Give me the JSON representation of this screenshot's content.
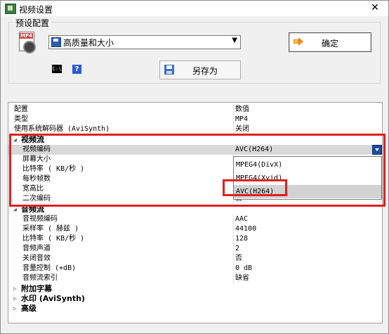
{
  "window": {
    "title": "视频设置",
    "close": "✕"
  },
  "preset": {
    "legend": "预设配置",
    "selected": "高质量和大小",
    "ok_label": "确定",
    "save_as_label": "另存为",
    "file_icon_label": "MP4",
    "cmd_icon_label": "C:\\",
    "help_icon_label": "?"
  },
  "grid": {
    "header": {
      "key": "配置",
      "value": "数值"
    },
    "top_rows": [
      {
        "key": "类型",
        "value": "MP4"
      },
      {
        "key": "使用系统解码器 (AviSynth)",
        "value": "关闭"
      }
    ],
    "video": {
      "label": "视频流",
      "rows": [
        {
          "key": "视频编码",
          "value": "AVC(H264)"
        },
        {
          "key": "屏幕大小",
          "value": ""
        },
        {
          "key": "比特率 ( KB/秒 )",
          "value": ""
        },
        {
          "key": "每秒帧数",
          "value": ""
        },
        {
          "key": "宽高比",
          "value": ""
        },
        {
          "key": "二次编码",
          "value": "否"
        }
      ],
      "dropdown_options": [
        "MPEG4(DivX)",
        "MPEG4(Xvid)",
        "AVC(H264)"
      ]
    },
    "audio": {
      "label": "音频流",
      "rows": [
        {
          "key": "音视频编码",
          "value": "AAC"
        },
        {
          "key": "采样率 ( 赫兹 )",
          "value": "44100"
        },
        {
          "key": "比特率 ( KB/秒 )",
          "value": "128"
        },
        {
          "key": "音频声道",
          "value": "2"
        },
        {
          "key": "关闭音效",
          "value": "否"
        },
        {
          "key": "音量控制 (+dB)",
          "value": "0 dB"
        },
        {
          "key": "音频流索引",
          "value": "缺省"
        }
      ]
    },
    "collapsed": [
      {
        "label": "附加字幕"
      },
      {
        "label": "水印 (AviSynth)"
      },
      {
        "label": "高级"
      }
    ]
  },
  "colors": {
    "highlight": "#e02020",
    "selection": "#d9d9d9"
  }
}
